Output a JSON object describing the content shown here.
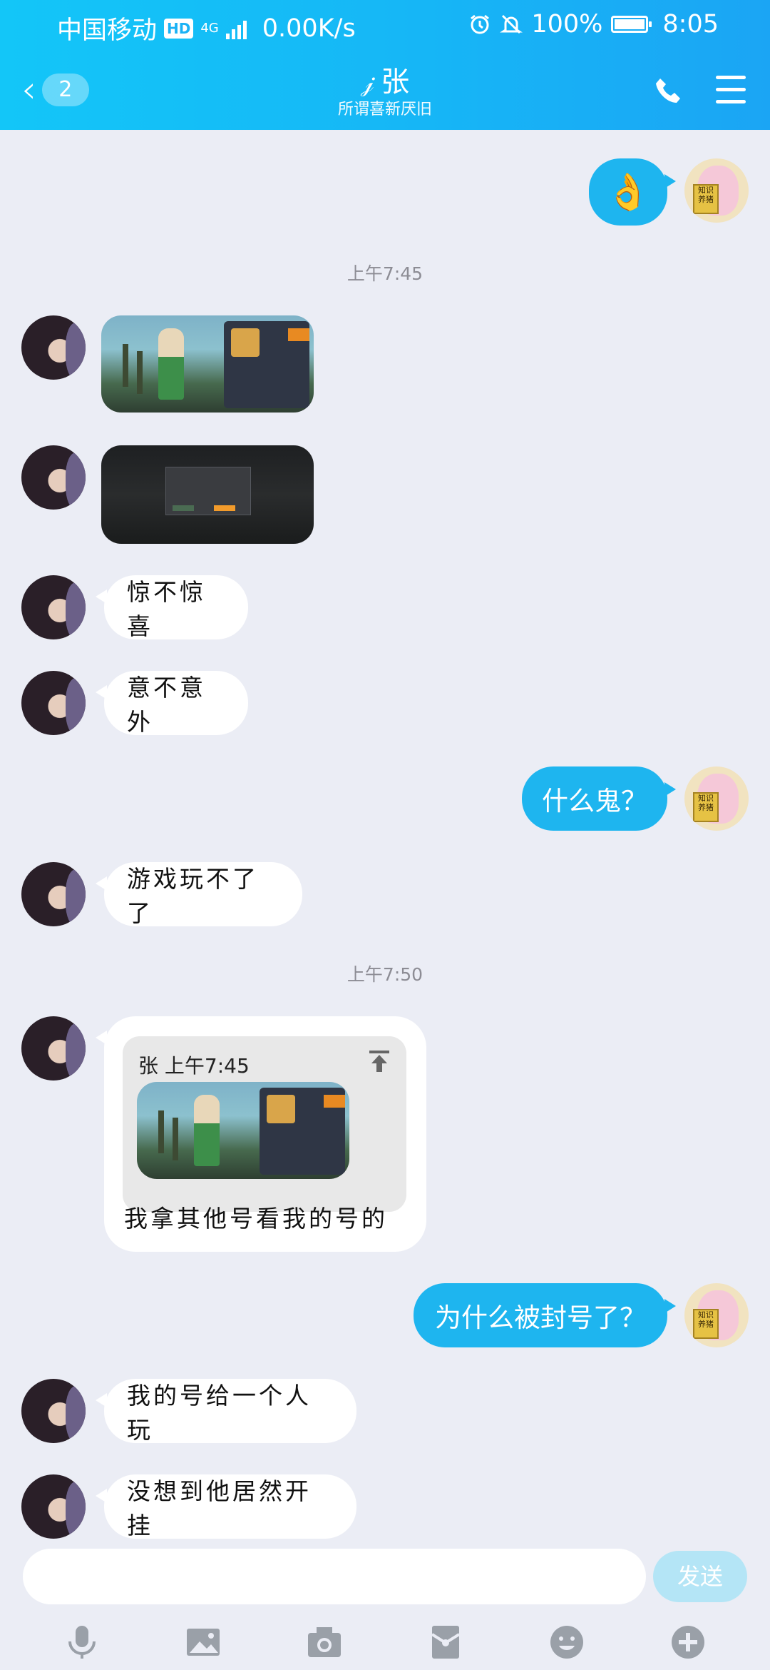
{
  "status_bar": {
    "carrier": "中国移动",
    "hd": "HD",
    "network": "4G",
    "speed": "0.00K/s",
    "battery": "100%",
    "time": "8:05"
  },
  "nav": {
    "back_count": "2",
    "contact_name": "张",
    "signature": "所谓喜新厌旧"
  },
  "messages": {
    "m1_emoji": "👌",
    "ts1": "上午7:45",
    "m4": "惊不惊喜",
    "m5": "意不意外",
    "m6": "什么鬼？",
    "m7": "游戏玩不了了",
    "ts2": "上午7:50",
    "m8_quote_header": "张 上午7:45",
    "m8_text": "我拿其他号看我的号的",
    "m9": "为什么被封号了？",
    "m10": "我的号给一个人玩",
    "m11": "没想到他居然开挂"
  },
  "avatar": {
    "me_book_text": "知识养猪"
  },
  "composer": {
    "placeholder": "",
    "send_label": "发送"
  },
  "toolbar": [
    "microphone-icon",
    "image-icon",
    "camera-icon",
    "red-packet-icon",
    "emoji-icon",
    "plus-icon"
  ],
  "colors": {
    "header": "#16b6f6",
    "outgoing_bubble": "#1eb5ef",
    "background": "#ebedf5",
    "send_disabled": "#b4e5f6"
  }
}
